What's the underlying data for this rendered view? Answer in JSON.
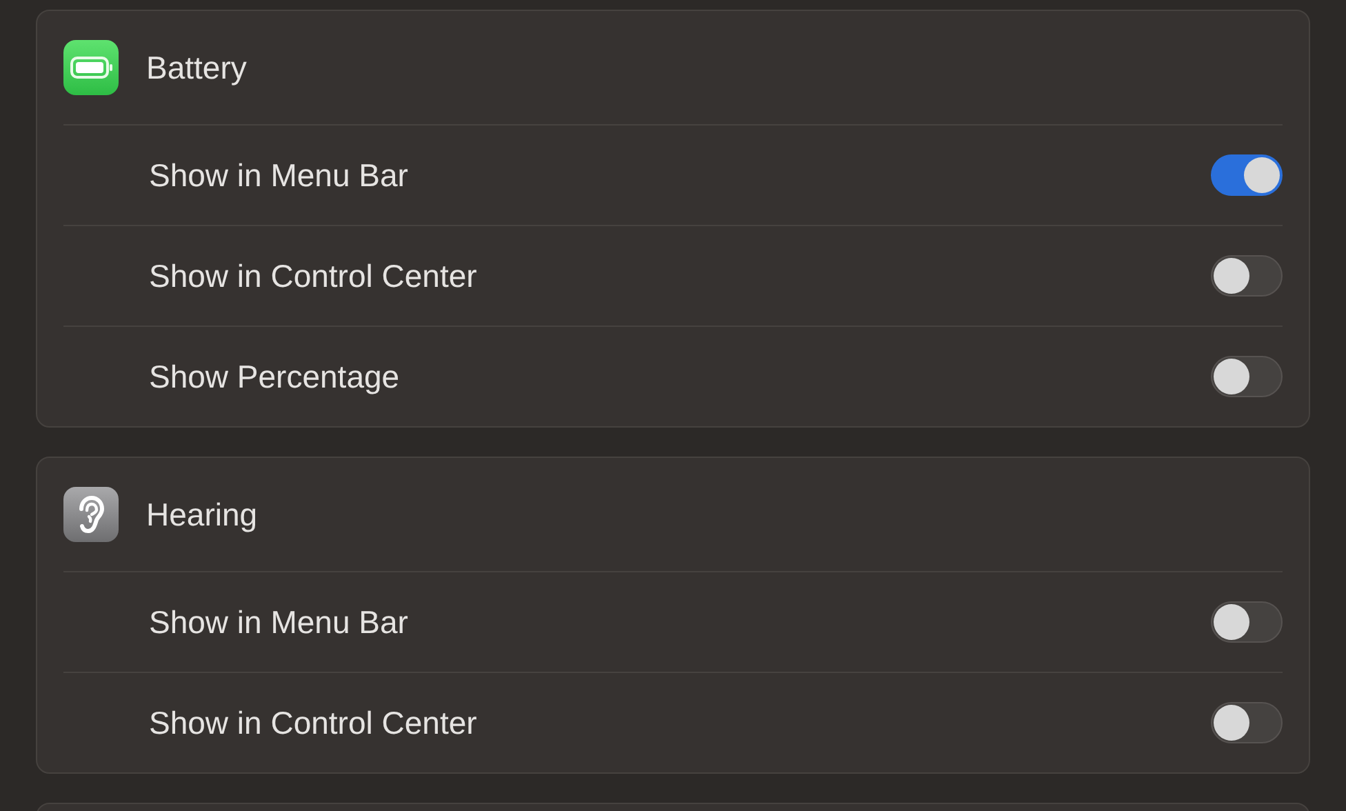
{
  "sections": [
    {
      "title": "Battery",
      "kind": "battery",
      "settings": [
        {
          "label": "Show in Menu Bar",
          "on": true
        },
        {
          "label": "Show in Control Center",
          "on": false
        },
        {
          "label": "Show Percentage",
          "on": false
        }
      ]
    },
    {
      "title": "Hearing",
      "kind": "hearing",
      "settings": [
        {
          "label": "Show in Menu Bar",
          "on": false
        },
        {
          "label": "Show in Control Center",
          "on": false
        }
      ]
    }
  ]
}
